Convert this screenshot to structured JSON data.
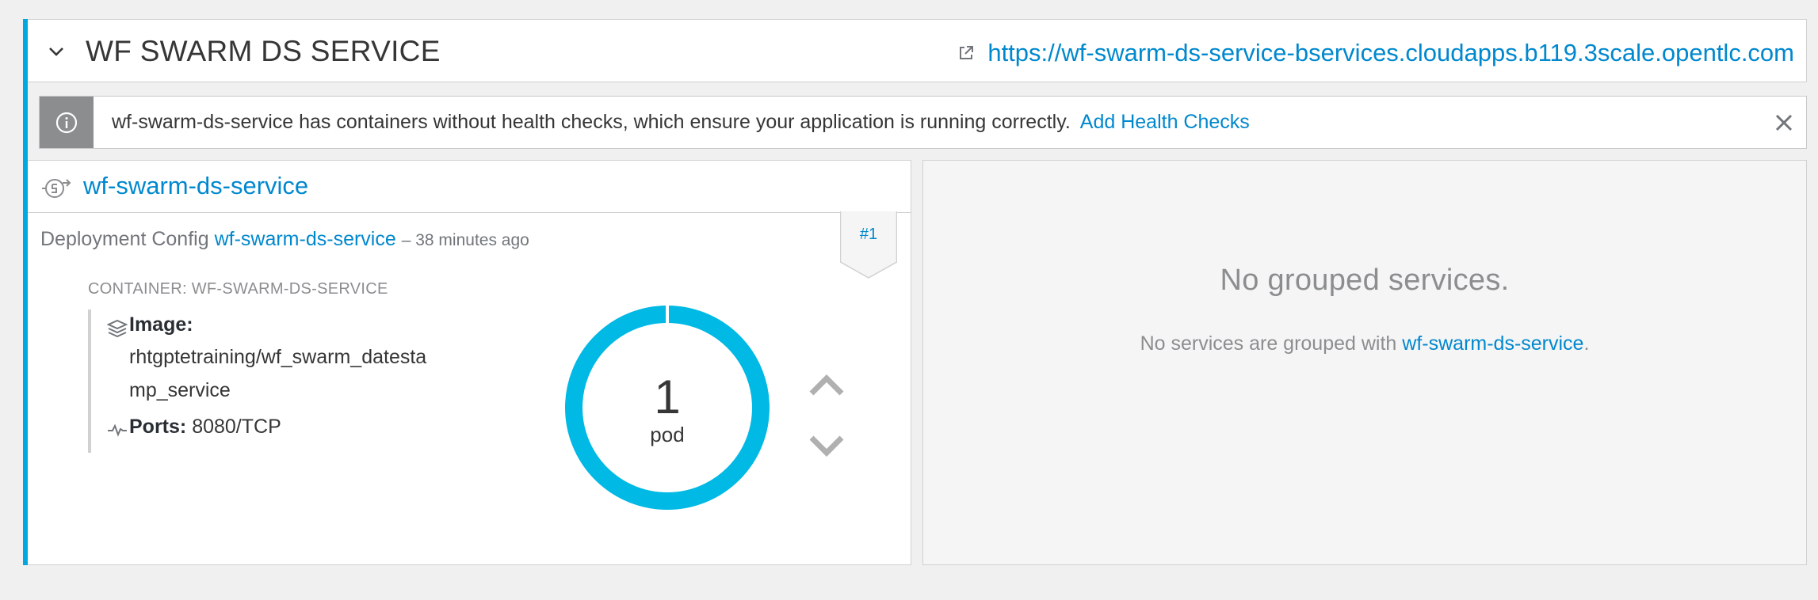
{
  "service": {
    "title": "WF SWARM DS SERVICE",
    "route_url": "https://wf-swarm-ds-service-bservices.cloudapps.b119.3scale.opentlc.com",
    "collapse_icon": "chevron-down-icon",
    "external_link_icon": "external-link-icon"
  },
  "alert": {
    "icon": "info-icon",
    "message": "wf-swarm-ds-service has containers without health checks, which ensure your application is running correctly.",
    "action_label": "Add Health Checks",
    "close_icon": "close-icon"
  },
  "deployment": {
    "name": "wf-swarm-ds-service",
    "icon": "deployment-config-icon",
    "config_prefix": "Deployment Config",
    "config_link": "wf-swarm-ds-service",
    "age": "– 38 minutes ago",
    "revision": "#1",
    "container_label": "CONTAINER: WF-SWARM-DS-SERVICE",
    "image_label": "Image:",
    "image_line1": "rhtgptetraining/wf_swarm_datesta",
    "image_line2": "mp_service",
    "ports_label": "Ports:",
    "ports_value": "8080/TCP",
    "pod_count": "1",
    "pod_label": "pod",
    "scale_up_icon": "chevron-up-icon",
    "scale_down_icon": "chevron-down-icon"
  },
  "grouped": {
    "title": "No grouped services.",
    "sub_prefix": "No services are grouped with ",
    "sub_link": "wf-swarm-ds-service",
    "sub_suffix": "."
  },
  "colors": {
    "accent": "#00a8e1",
    "link": "#0088ce",
    "alert_icon_bg": "#8b8d8f"
  }
}
